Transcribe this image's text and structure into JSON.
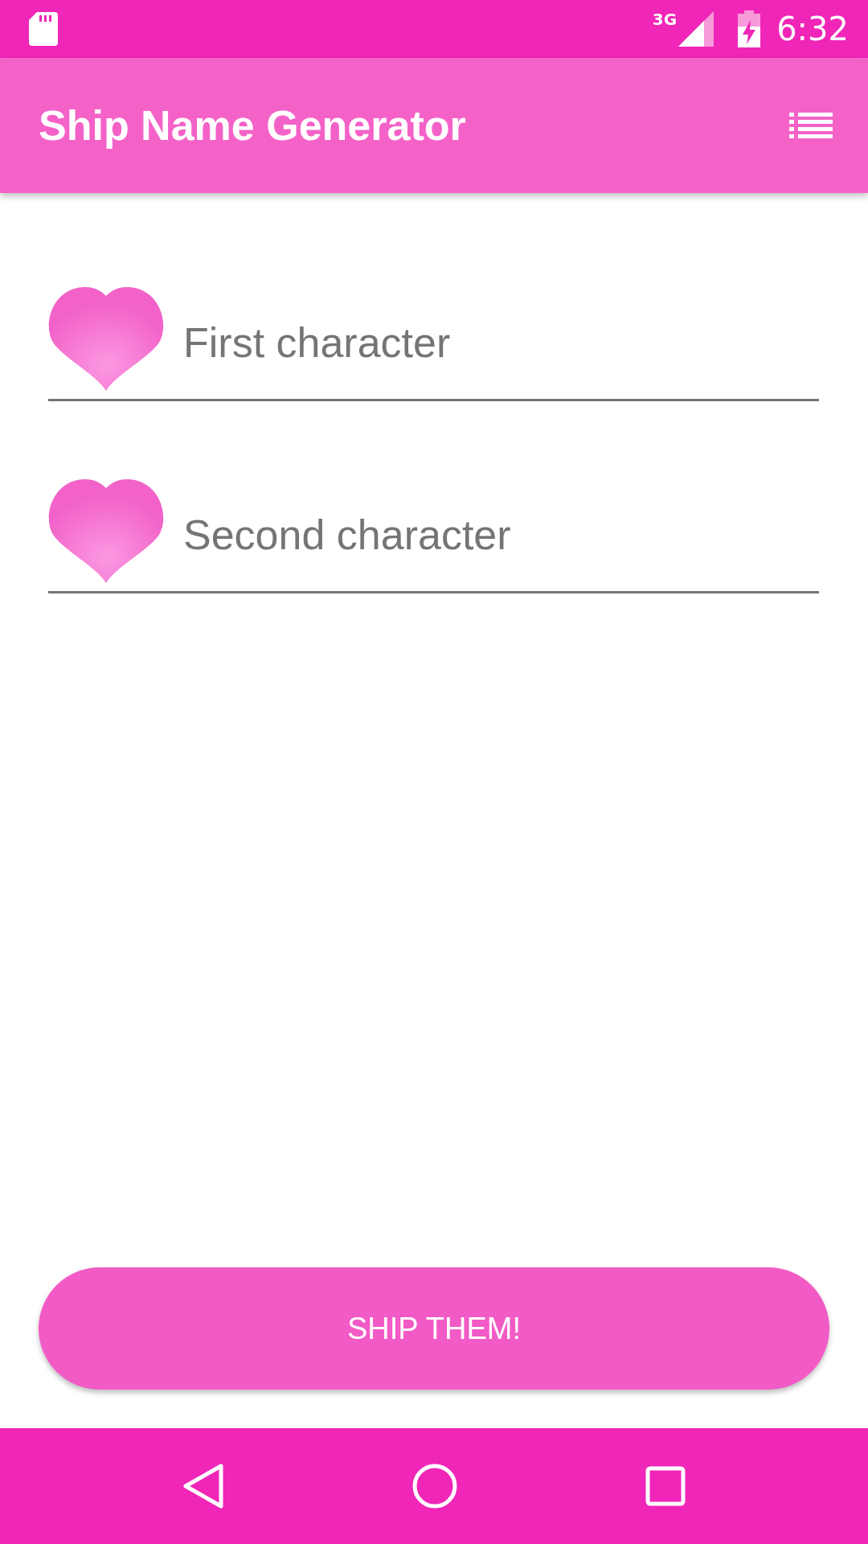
{
  "status_bar": {
    "network": "3G",
    "time": "6:32"
  },
  "toolbar": {
    "title": "Ship Name Generator"
  },
  "fields": [
    {
      "placeholder": "First character"
    },
    {
      "placeholder": "Second character"
    }
  ],
  "button": {
    "label": "SHIP THEM!"
  }
}
